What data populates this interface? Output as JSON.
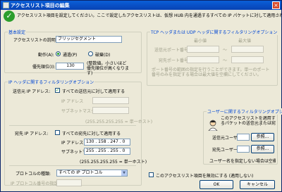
{
  "window": {
    "title": "アクセスリスト項目の編集",
    "close_glyph": "×"
  },
  "header": {
    "text": "アクセスリスト項目を設定してください。ここで設定したアクセスリストは、仮想 HUB 内を通過するすべての IP パケットに対して適用されます。"
  },
  "basic": {
    "group_title": "基本設定",
    "name_label": "アクセスリストの説明(N):",
    "name_value": "ブリッジセグメント",
    "action_label": "動作(A):",
    "pass_label": "通過(P)",
    "discard_label": "破棄(D)",
    "priority_label": "優先順位(I):",
    "priority_value": "130",
    "priority_hint": "(整数値。小さいほど 優先順位が高くなります)"
  },
  "ip": {
    "group_title": "IP ヘッダに関するフィルタリングオプション",
    "src_label": "送信元 IP アドレス:",
    "src_all_label": "すべての送信元に対して適用する",
    "src_addr_label": "IP アドレス",
    "src_mask_label": "サブネットマスク",
    "src_mask_hint": "(255.255.255.255 = 単一ホスト)",
    "dst_label": "宛先 IP アドレス:",
    "dst_all_label": "すべての宛先に対して適用する",
    "dst_addr_label": "IP アドレス",
    "dst_addr_value": "130 . 158 . 247 . 0",
    "dst_mask_label": "サブネットマスク",
    "dst_mask_value": "255 . 255 . 255 . 0",
    "dst_mask_hint": "(255.255.255.255 = 単一ホスト)",
    "proto_label": "プロトコルの種類:",
    "proto_value": "すべての IP プロトコル",
    "proto_num_label": "IP プロトコル番号の指定:"
  },
  "tcp": {
    "group_title": "TCP ヘッダまたは UDP ヘッダに関するフィルタリングオプション",
    "min_label": "最小値",
    "max_label": "最大値",
    "src_port_label": "送信元ポート番号:",
    "dst_port_label": "宛先ポート番号:",
    "tilde": "～",
    "hint": "ポート番号の範囲の指定を行うことができます。単一のポート番号のみを指定する場合は最大値を空欄にしてください。"
  },
  "user": {
    "group_title": "ユーザーに関するフィルタリングオプション",
    "desc": "このアクセスリストを適用するパケットの送信元または宛先のユーザー名を指定することができます。",
    "src_user_label": "送信元ユーザー名:",
    "dst_user_label": "宛先ユーザー名:",
    "browse_label": "参照...",
    "hint": "ユーザー名を指定しない場合は空欄にしてください。"
  },
  "disable_label": "このアクセスリスト項目を無効にする (適用しない)",
  "ok_label": "OK",
  "cancel_label": "キャンセル",
  "colors": {
    "title_bar": "#0a5fd8",
    "group_title": "#0046d5"
  }
}
